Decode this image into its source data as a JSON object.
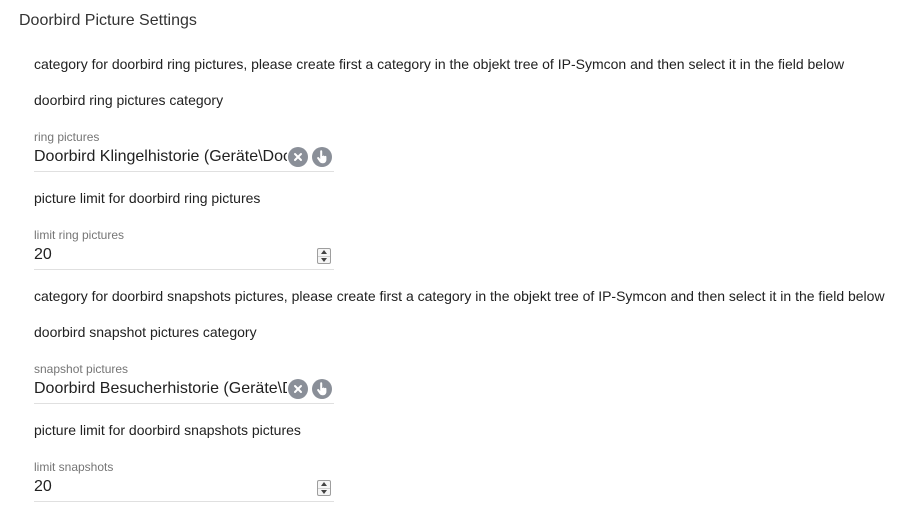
{
  "section": {
    "title": "Doorbird Picture Settings"
  },
  "ring": {
    "description": "category for doorbird ring pictures, please create first a category in the objekt tree of IP-Symcon and then select it in the field below",
    "category_label": "doorbird ring pictures category",
    "select": {
      "caption": "ring pictures",
      "value": "Doorbird Klingelhistorie (Geräte\\Doorbird)",
      "clear_icon": "close-circle-icon",
      "pick_icon": "pointer-hand-icon"
    },
    "limit_label": "picture limit for doorbird ring pictures",
    "limit": {
      "caption": "limit ring pictures",
      "value": "20"
    }
  },
  "snapshot": {
    "description": "category for doorbird snapshots pictures, please create first a category in the objekt tree of IP-Symcon and then select it in the field below",
    "category_label": "doorbird snapshot pictures category",
    "select": {
      "caption": "snapshot pictures",
      "value": "Doorbird Besucherhistorie (Geräte\\Doorbird)",
      "clear_icon": "close-circle-icon",
      "pick_icon": "pointer-hand-icon"
    },
    "limit_label": "picture limit for doorbird snapshots pictures",
    "limit": {
      "caption": "limit snapshots",
      "value": "20"
    }
  },
  "colors": {
    "icon_bg": "#8a8f98",
    "underline": "#e0e0e0",
    "caption": "#757575"
  }
}
